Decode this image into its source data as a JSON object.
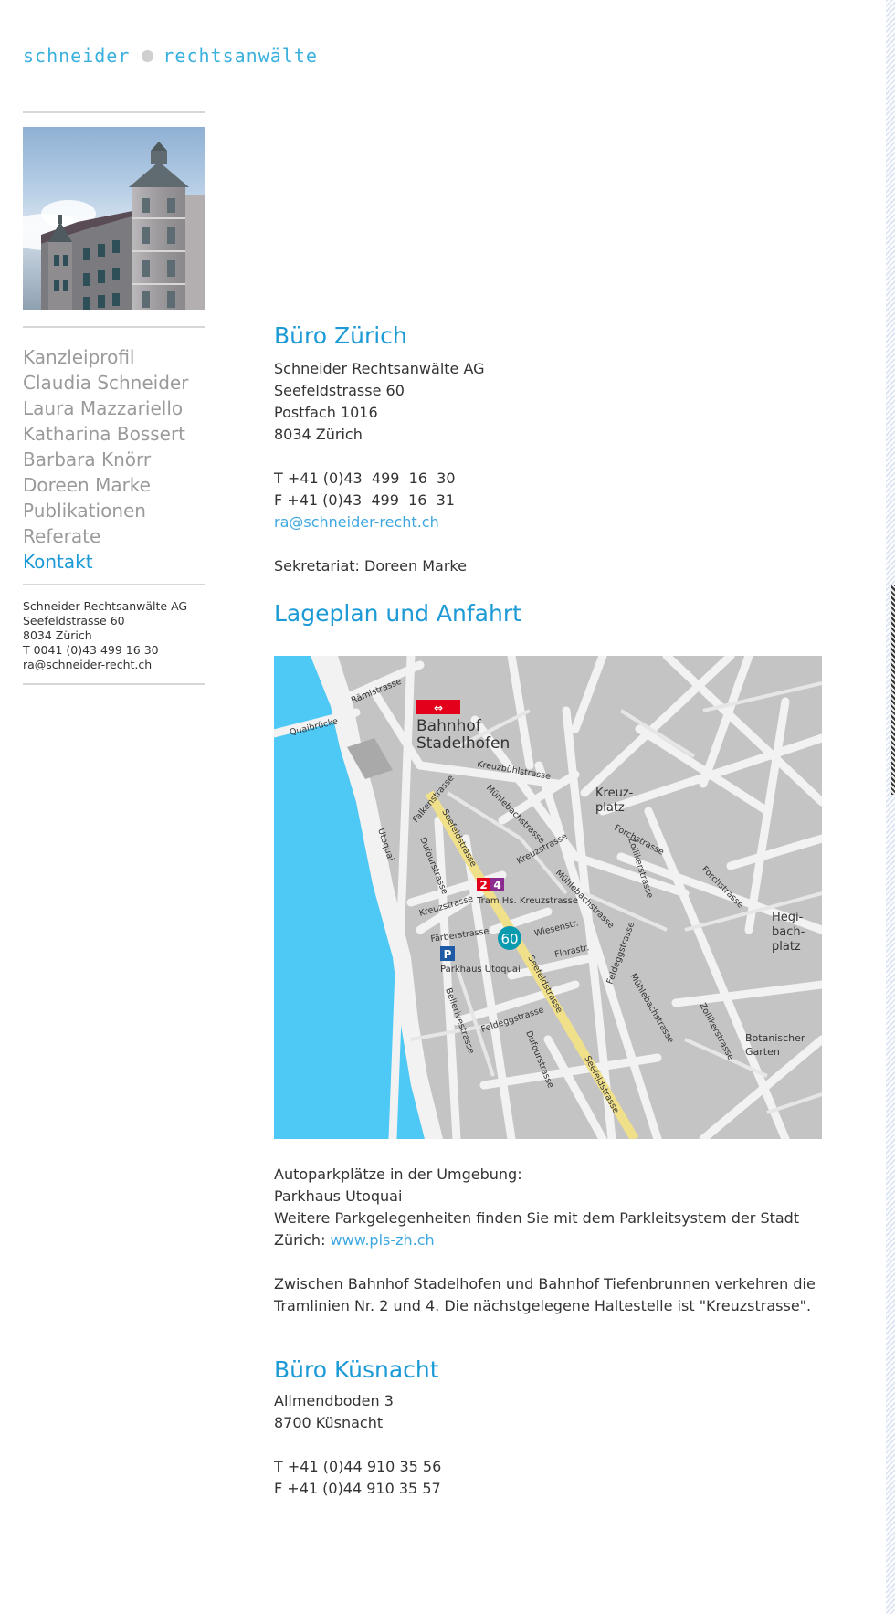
{
  "logo": {
    "left": "schneider",
    "right": "rechtsanwälte"
  },
  "sidebar": {
    "nav": [
      {
        "label": "Kanzleiprofil",
        "active": false
      },
      {
        "label": "Claudia Schneider",
        "active": false
      },
      {
        "label": "Laura Mazzariello",
        "active": false
      },
      {
        "label": "Katharina Bossert",
        "active": false
      },
      {
        "label": "Barbara Knörr",
        "active": false
      },
      {
        "label": "Doreen Marke",
        "active": false
      },
      {
        "label": "Publikationen",
        "active": false
      },
      {
        "label": "Referate",
        "active": false
      },
      {
        "label": "Kontakt",
        "active": true
      }
    ],
    "address": {
      "company": "Schneider Rechtsanwälte AG",
      "street": "Seefeldstrasse 60",
      "city": "8034 Zürich",
      "phone": "T 0041 (0)43 499 16 30",
      "email": "ra@schneider-recht.ch"
    }
  },
  "zurich": {
    "title": "Büro Zürich",
    "company": "Schneider Rechtsanwälte AG",
    "street": "Seefeldstrasse 60",
    "postbox": "Postfach 1016",
    "city": "8034 Zürich",
    "phone": "T +41 (0)43  499  16  30",
    "fax": "F +41 (0)43  499  16  31",
    "email": "ra@schneider-recht.ch",
    "secretariat": "Sekretariat: Doreen Marke"
  },
  "map_section": {
    "title": "Lageplan und Anfahrt",
    "map": {
      "station": [
        "Bahnhof",
        "Stadelhofen"
      ],
      "tram_numbers": [
        "2",
        "4"
      ],
      "tram_stop": "Tram Hs. Kreuzstrasse",
      "building_number": "60",
      "parking_symbol": "P",
      "parking": "Parkhaus Utoquai",
      "kreuzplatz": [
        "Kreuz-",
        "platz"
      ],
      "hegibachplatz": [
        "Hegi-",
        "bach-",
        "platz"
      ],
      "garden": [
        "Botanischer",
        "Garten"
      ],
      "streets": {
        "ramistrasse": "Rämistrasse",
        "quaibruecke": "Quaibrücke",
        "kreuzbuehlstrasse": "Kreuzbühlstrasse",
        "falkenstrasse": "Falkenstrasse",
        "muehlebachstrasse": "Mühlebachstrasse",
        "seefeldstrasse": "Seefeldstrasse",
        "utoquai": "Utoquai",
        "dufourstrasse": "Dufourstrasse",
        "kreuzstrasse": "Kreuzstrasse",
        "faerberstrasse": "Färberstrasse",
        "wiesenstr": "Wiesenstr.",
        "florastr": "Florastr.",
        "feldeggstrasse": "Feldeggstrasse",
        "bellerivestrasse": "Bellerivestrasse",
        "forchstrasse": "Forchstrasse",
        "zollikerstrasse": "Zollikerstrasse"
      }
    },
    "parking_intro": "Autoparkplätze in der Umgebung:",
    "parking_name": "Parkhaus Utoquai",
    "parking_more_1": "Weitere Parkgelegenheiten finden Sie mit dem Parkleitsystem der Stadt",
    "parking_more_2": "Zürich: ",
    "parking_link": "www.pls-zh.ch",
    "tram_1": "Zwischen Bahnhof Stadelhofen und Bahnhof Tiefenbrunnen verkehren die",
    "tram_2": "Tramlinien Nr. 2 und 4. Die nächstgelegene Haltestelle ist \"Kreuzstrasse\"."
  },
  "kuesnacht": {
    "title": "Büro Küsnacht",
    "street": "Allmendboden 3",
    "city": "8700 Küsnacht",
    "phone": "T +41 (0)44 910 35 56",
    "fax": "F +41 (0)44 910 35 57"
  },
  "colors": {
    "accent": "#1c9ad6",
    "nav_inactive": "#9a9a9a",
    "lake": "#4ec8f5",
    "map_road": "#f2f2f2",
    "map_block": "#c4c4c4",
    "seefeld_highlight": "#f1e08a",
    "sbb_red": "#e3001b"
  }
}
